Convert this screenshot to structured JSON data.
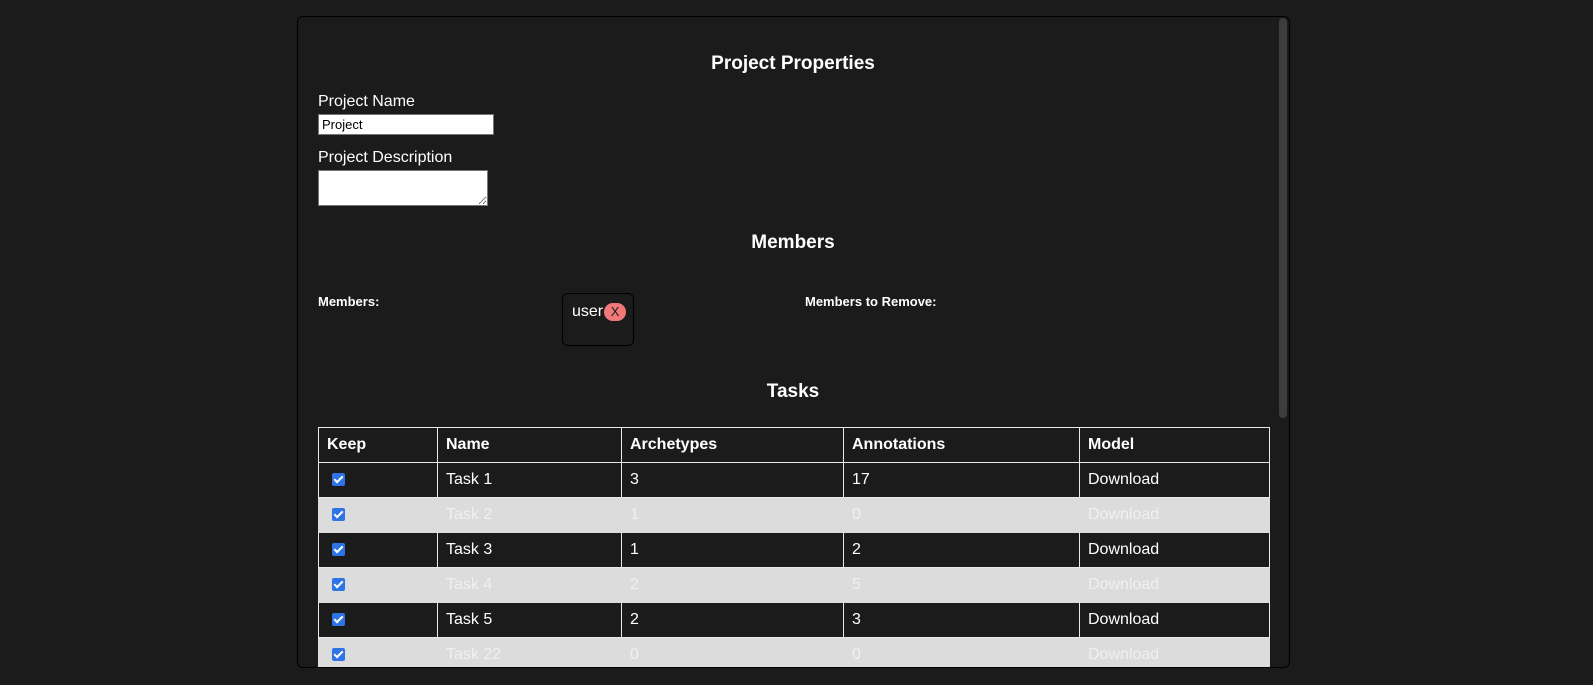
{
  "properties": {
    "heading": "Project Properties",
    "name_label": "Project Name",
    "name_value": "Project",
    "description_label": "Project Description",
    "description_value": ""
  },
  "members": {
    "heading": "Members",
    "members_label": "Members:",
    "remove_label": "Members to Remove:",
    "chip_user": "user",
    "chip_remove": "X"
  },
  "tasks": {
    "heading": "Tasks",
    "columns": [
      "Keep",
      "Name",
      "Archetypes",
      "Annotations",
      "Model"
    ],
    "rows": [
      {
        "keep": true,
        "name": "Task 1",
        "archetypes": "3",
        "annotations": "17",
        "model": "Download"
      },
      {
        "keep": true,
        "name": "Task 2",
        "archetypes": "1",
        "annotations": "0",
        "model": "Download"
      },
      {
        "keep": true,
        "name": "Task 3",
        "archetypes": "1",
        "annotations": "2",
        "model": "Download"
      },
      {
        "keep": true,
        "name": "Task 4",
        "archetypes": "2",
        "annotations": "5",
        "model": "Download"
      },
      {
        "keep": true,
        "name": "Task 5",
        "archetypes": "2",
        "annotations": "3",
        "model": "Download"
      },
      {
        "keep": true,
        "name": "Task 22",
        "archetypes": "0",
        "annotations": "0",
        "model": "Download"
      }
    ]
  },
  "colors": {
    "background": "#1b1b1b",
    "row_alt": "#dcdcdc",
    "chip_remove": "#f07878",
    "checkbox": "#2f74e6"
  }
}
